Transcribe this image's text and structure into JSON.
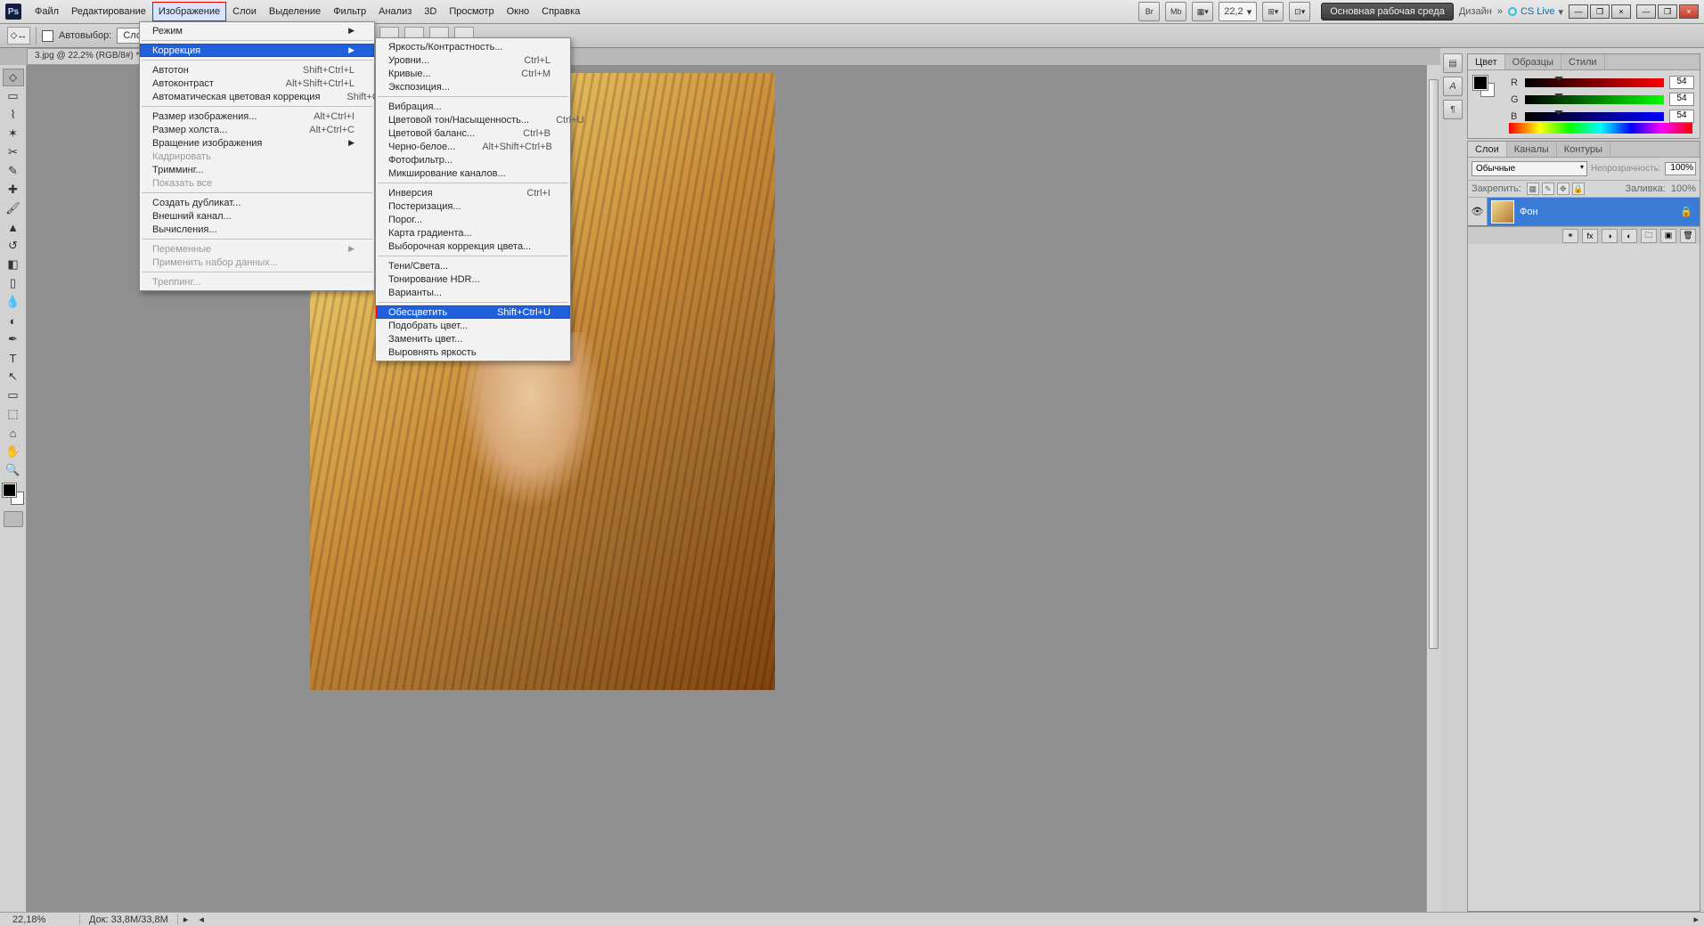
{
  "menubar": {
    "items": [
      "Файл",
      "Редактирование",
      "Изображение",
      "Слои",
      "Выделение",
      "Фильтр",
      "Анализ",
      "3D",
      "Просмотр",
      "Окно",
      "Справка"
    ],
    "zoom_combo": "22,2",
    "workspace_primary": "Основная рабочая среда",
    "workspace_secondary": "Дизайн",
    "cslive": "CS Live"
  },
  "optionsbar": {
    "auto_select_label": "Автовыбор:",
    "target": "Слой"
  },
  "document_tab": "3.jpg @ 22,2% (RGB/8#) *",
  "image_menu": {
    "groups": [
      [
        {
          "label": "Режим",
          "arrow": true
        }
      ],
      [
        {
          "label": "Коррекция",
          "arrow": true,
          "highlight": true,
          "boxed": true
        }
      ],
      [
        {
          "label": "Автотон",
          "shortcut": "Shift+Ctrl+L"
        },
        {
          "label": "Автоконтраст",
          "shortcut": "Alt+Shift+Ctrl+L"
        },
        {
          "label": "Автоматическая цветовая коррекция",
          "shortcut": "Shift+Ctrl+B"
        }
      ],
      [
        {
          "label": "Размер изображения...",
          "shortcut": "Alt+Ctrl+I"
        },
        {
          "label": "Размер холста...",
          "shortcut": "Alt+Ctrl+C"
        },
        {
          "label": "Вращение изображения",
          "arrow": true
        },
        {
          "label": "Кадрировать",
          "disabled": true
        },
        {
          "label": "Тримминг..."
        },
        {
          "label": "Показать все",
          "disabled": true
        }
      ],
      [
        {
          "label": "Создать дубликат..."
        },
        {
          "label": "Внешний канал..."
        },
        {
          "label": "Вычисления..."
        }
      ],
      [
        {
          "label": "Переменные",
          "arrow": true,
          "disabled": true
        },
        {
          "label": "Применить набор данных...",
          "disabled": true
        }
      ],
      [
        {
          "label": "Треппинг...",
          "disabled": true
        }
      ]
    ]
  },
  "correction_menu": {
    "groups": [
      [
        {
          "label": "Яркость/Контрастность..."
        },
        {
          "label": "Уровни...",
          "shortcut": "Ctrl+L"
        },
        {
          "label": "Кривые...",
          "shortcut": "Ctrl+M"
        },
        {
          "label": "Экспозиция..."
        }
      ],
      [
        {
          "label": "Вибрация..."
        },
        {
          "label": "Цветовой тон/Насыщенность...",
          "shortcut": "Ctrl+U"
        },
        {
          "label": "Цветовой баланс...",
          "shortcut": "Ctrl+B"
        },
        {
          "label": "Черно-белое...",
          "shortcut": "Alt+Shift+Ctrl+B"
        },
        {
          "label": "Фотофильтр..."
        },
        {
          "label": "Микширование каналов..."
        }
      ],
      [
        {
          "label": "Инверсия",
          "shortcut": "Ctrl+I"
        },
        {
          "label": "Постеризация..."
        },
        {
          "label": "Порог..."
        },
        {
          "label": "Карта градиента..."
        },
        {
          "label": "Выборочная коррекция цвета..."
        }
      ],
      [
        {
          "label": "Тени/Света..."
        },
        {
          "label": "Тонирование HDR..."
        },
        {
          "label": "Варианты..."
        }
      ],
      [
        {
          "label": "Обесцветить",
          "shortcut": "Shift+Ctrl+U",
          "highlight": true,
          "boxed": true
        },
        {
          "label": "Подобрать цвет..."
        },
        {
          "label": "Заменить цвет..."
        },
        {
          "label": "Выровнять яркость"
        }
      ]
    ]
  },
  "color_panel": {
    "tabs": [
      "Цвет",
      "Образцы",
      "Стили"
    ],
    "r": {
      "label": "R",
      "value": "54"
    },
    "g": {
      "label": "G",
      "value": "54"
    },
    "b": {
      "label": "B",
      "value": "54"
    }
  },
  "layers_panel": {
    "tabs": [
      "Слои",
      "Каналы",
      "Контуры"
    ],
    "blend": "Обычные",
    "opacity_label": "Непрозрачность:",
    "opacity": "100%",
    "lock_label": "Закрепить:",
    "fill_label": "Заливка:",
    "fill": "100%",
    "layer_name": "Фон"
  },
  "status": {
    "zoom": "22,18%",
    "doc": "Док: 33,8M/33,8M"
  }
}
